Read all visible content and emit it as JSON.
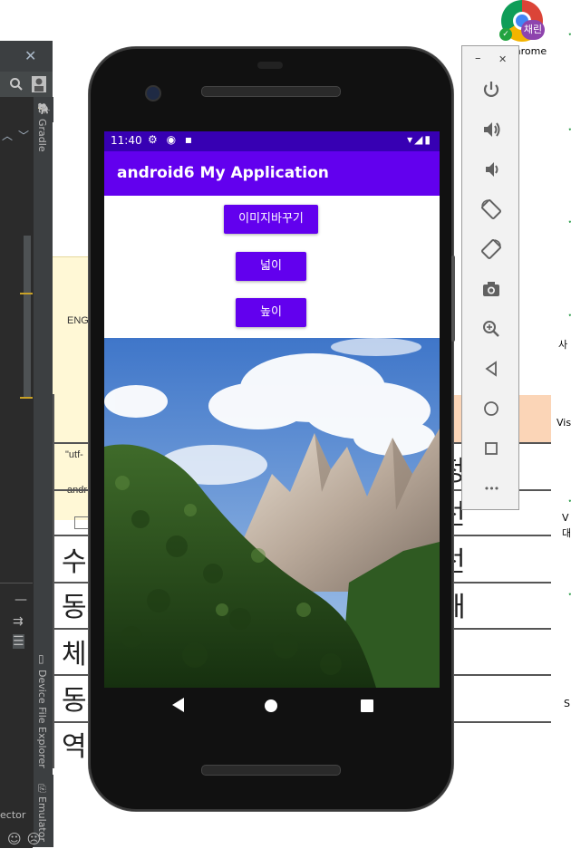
{
  "ide": {
    "close_glyph": "✕",
    "gradle_label": "Gradle",
    "device_file_explorer_label": "Device File Explorer",
    "emulator_label": "Emulator",
    "inspector_fragment": "ector",
    "smileys": "☺☹"
  },
  "document": {
    "fragment_eng": "ENG",
    "fragment_utf": "\"utf-",
    "fragment_andr": "andr",
    "grid_cells": [
      {
        "row": 0,
        "text": "수"
      },
      {
        "row": 1,
        "text": "동사"
      },
      {
        "row": 2,
        "text": "체"
      },
      {
        "row": 3,
        "text": "동사"
      },
      {
        "row": 4,
        "text": "역"
      }
    ],
    "right_cells": [
      "정",
      "선",
      "선",
      "재"
    ]
  },
  "desktop": {
    "chrome_badge": "채린",
    "chrome_label": "Chrome",
    "side_fragments": [
      "사",
      "Vis",
      "V",
      "대",
      "S"
    ]
  },
  "phone": {
    "status_bar": {
      "time": "11:40",
      "left_icons": "⚙ ◉ ▪",
      "right_icons": "▾◢▮"
    },
    "app_bar": {
      "title": "android6 My Application"
    },
    "buttons": [
      {
        "label": "이미지바꾸기"
      },
      {
        "label": "넓이"
      },
      {
        "label": "높이"
      }
    ],
    "image_description_label": "mountain landscape",
    "nav": {
      "back": "back",
      "home": "home",
      "recents": "recents"
    }
  },
  "emulator_toolbar": {
    "minimize_glyph": "–",
    "close_glyph": "✕",
    "tools": [
      {
        "name": "power"
      },
      {
        "name": "volume-up"
      },
      {
        "name": "volume-down"
      },
      {
        "name": "rotate-left"
      },
      {
        "name": "rotate-right"
      },
      {
        "name": "screenshot"
      },
      {
        "name": "zoom"
      },
      {
        "name": "back"
      },
      {
        "name": "home"
      },
      {
        "name": "overview"
      },
      {
        "name": "more"
      }
    ],
    "more_glyph": "•••"
  },
  "colors": {
    "status_bar": "#3700b3",
    "app_bar": "#6200ee",
    "button": "#6200ee",
    "ide_bg": "#3c3f41",
    "doc_peach": "#fbd5b7"
  }
}
